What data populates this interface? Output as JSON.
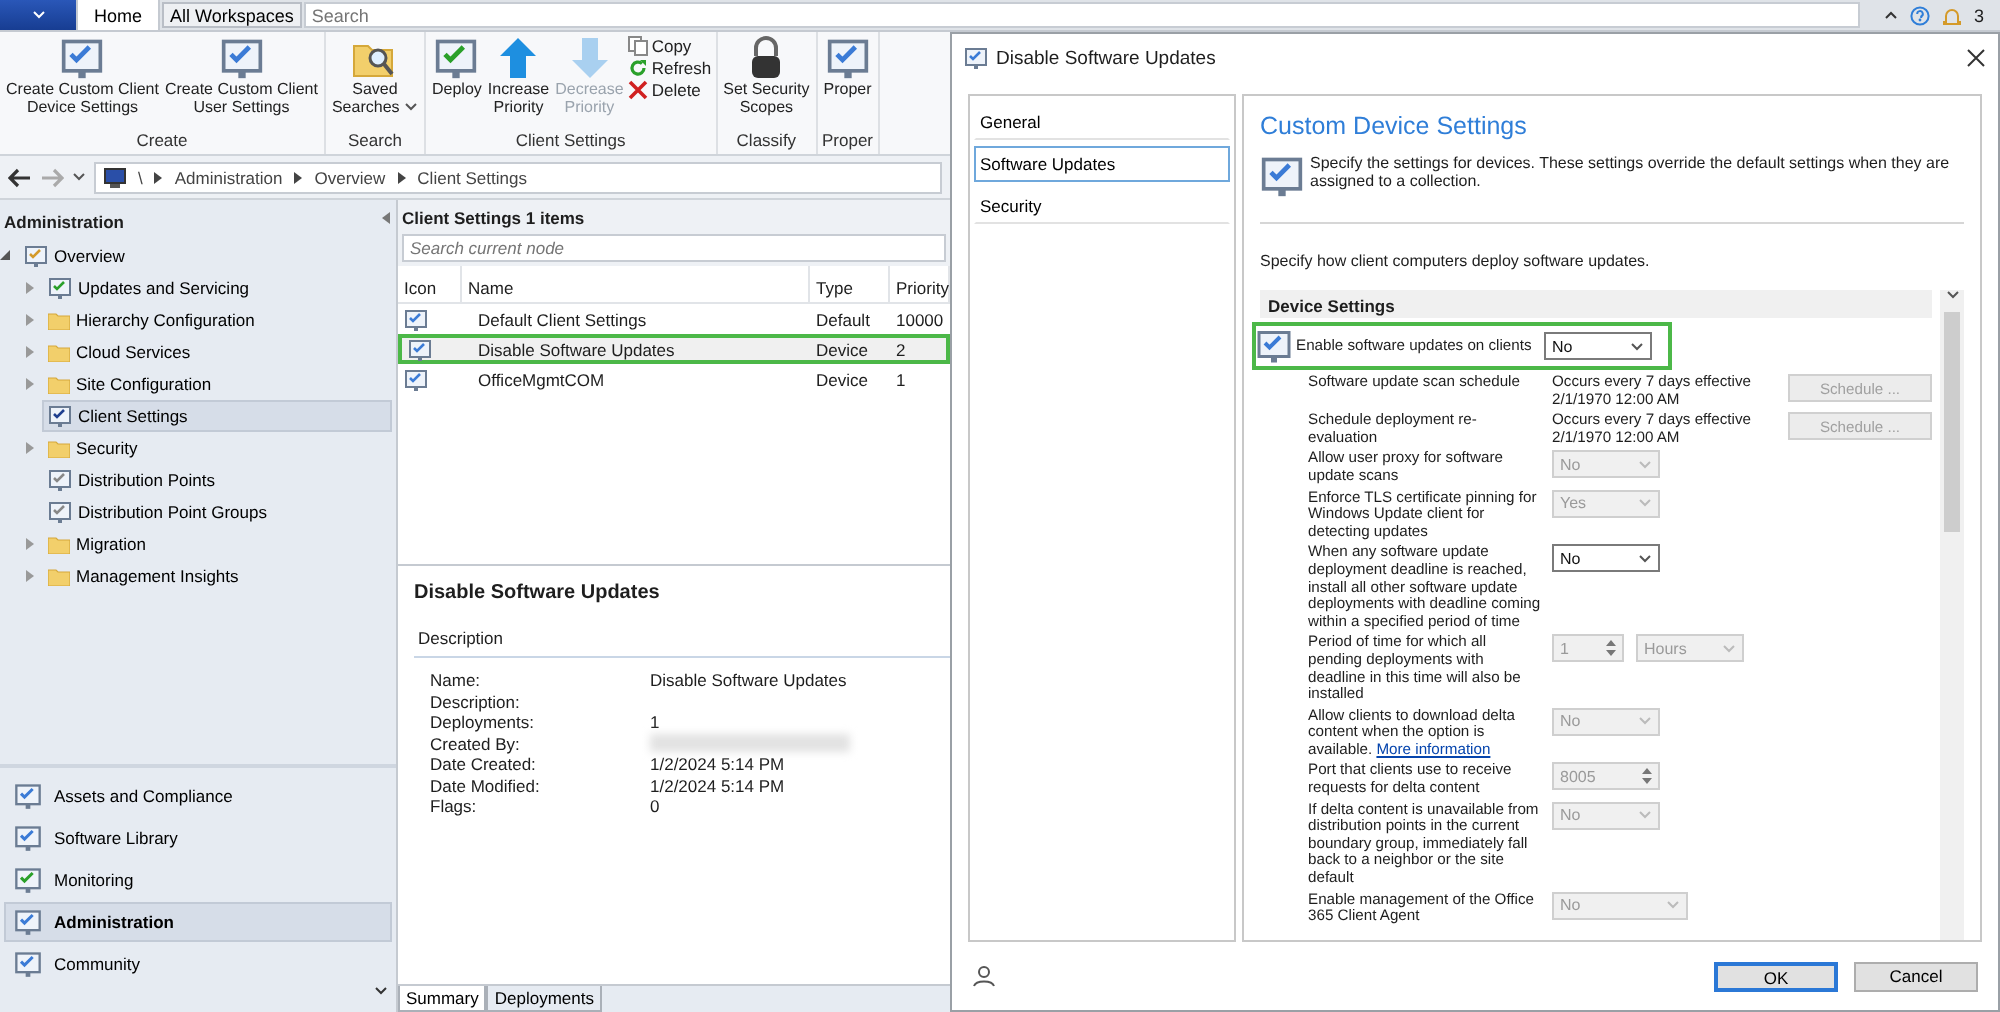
{
  "topbar": {
    "tabs": [
      {
        "label": "Home",
        "selected": true
      }
    ],
    "workspaces_button": "All Workspaces",
    "search": {
      "placeholder": "Search"
    },
    "notifications": "3"
  },
  "ribbon": {
    "groups": [
      {
        "label": "Create",
        "buttons": [
          {
            "kind": "large",
            "label": "Create Custom Client\nDevice Settings",
            "disabled": false
          },
          {
            "kind": "large",
            "label": "Create Custom Client\nUser Settings",
            "disabled": false
          }
        ]
      },
      {
        "label": "Search",
        "buttons": [
          {
            "kind": "menu",
            "label": "Saved\nSearches",
            "disabled": false
          }
        ]
      },
      {
        "label": "Client Settings",
        "buttons": [
          {
            "kind": "large",
            "label": "Deploy",
            "disabled": false
          },
          {
            "kind": "large",
            "label": "Increase\nPriority",
            "disabled": false
          },
          {
            "kind": "large",
            "label": "Decrease\nPriority",
            "disabled": true
          },
          {
            "kind": "small",
            "label": "Copy",
            "disabled": false
          },
          {
            "kind": "small",
            "label": "Refresh",
            "disabled": false
          },
          {
            "kind": "small",
            "label": "Delete",
            "disabled": false
          }
        ]
      },
      {
        "label": "Classify",
        "buttons": [
          {
            "kind": "large",
            "label": "Set Security\nScopes",
            "disabled": false
          }
        ]
      },
      {
        "label": "Proper",
        "buttons": [
          {
            "kind": "large",
            "label": "Proper",
            "disabled": false
          }
        ]
      }
    ]
  },
  "breadcrumb": [
    "\\",
    "Administration",
    "Overview",
    "Client Settings"
  ],
  "navigation": {
    "title": "Administration",
    "tree": [
      {
        "label": "Overview",
        "expanded": true,
        "children": [
          {
            "label": "Updates and Servicing",
            "expandable": true,
            "selected": false
          },
          {
            "label": "Hierarchy Configuration",
            "expandable": true,
            "selected": false
          },
          {
            "label": "Cloud Services",
            "expandable": true,
            "selected": false
          },
          {
            "label": "Site Configuration",
            "expandable": true,
            "selected": false
          },
          {
            "label": "Client Settings",
            "expandable": false,
            "selected": true
          },
          {
            "label": "Security",
            "expandable": true,
            "selected": false
          },
          {
            "label": "Distribution Points",
            "expandable": false,
            "selected": false
          },
          {
            "label": "Distribution Point Groups",
            "expandable": false,
            "selected": false
          },
          {
            "label": "Migration",
            "expandable": true,
            "selected": false
          },
          {
            "label": "Management Insights",
            "expandable": true,
            "selected": false
          }
        ]
      }
    ],
    "workspaces": [
      {
        "label": "Assets and Compliance",
        "selected": false
      },
      {
        "label": "Software Library",
        "selected": false
      },
      {
        "label": "Monitoring",
        "selected": false
      },
      {
        "label": "Administration",
        "selected": true
      },
      {
        "label": "Community",
        "selected": false
      }
    ]
  },
  "list": {
    "title": "Client Settings 1 items",
    "search": {
      "placeholder": "Search current node"
    },
    "columns": [
      "Icon",
      "Name",
      "Type",
      "Priority"
    ],
    "rows": [
      {
        "name": "Default Client Settings",
        "type": "Default",
        "priority": "10000",
        "highlighted": false
      },
      {
        "name": "Disable Software Updates",
        "type": "Device",
        "priority": "2",
        "highlighted": true
      },
      {
        "name": "OfficeMgmtCOM",
        "type": "Device",
        "priority": "1",
        "highlighted": false
      }
    ]
  },
  "details": {
    "title": "Disable Software Updates",
    "section": "Description",
    "properties": [
      {
        "label": "Name:",
        "value": "Disable Software Updates",
        "redacted": false
      },
      {
        "label": "Description:",
        "redacted": false
      },
      {
        "label": "Deployments:",
        "value": "1",
        "redacted": false
      },
      {
        "label": "Created By:",
        "redacted": true
      },
      {
        "label": "Date Created:",
        "value": "1/2/2024 5:14 PM",
        "redacted": false
      },
      {
        "label": "Date Modified:",
        "value": "1/2/2024 5:14 PM",
        "redacted": false
      },
      {
        "label": "Flags:",
        "value": "0",
        "redacted": false
      }
    ],
    "tabs": [
      {
        "label": "Summary",
        "selected": true
      },
      {
        "label": "Deployments",
        "selected": false
      }
    ]
  },
  "dialog": {
    "title": "Disable Software Updates",
    "pages": [
      {
        "label": "General",
        "selected": false
      },
      {
        "label": "Software Updates",
        "selected": true
      },
      {
        "label": "Security",
        "selected": false
      }
    ],
    "heading": "Custom Device Settings",
    "description": "Specify the settings for devices. These settings override the default settings when they are assigned to a collection.",
    "intro": "Specify how client computers deploy software updates.",
    "group": "Device Settings",
    "settings": [
      {
        "kind": "select",
        "label": "Enable software updates on clients",
        "value": "No",
        "disabled": false,
        "highlighted": true
      },
      {
        "kind": "schedule",
        "label": "Software update scan schedule",
        "schedule": "Occurs every 7 days effective 2/1/1970 12:00 AM",
        "button": "Schedule ...",
        "disabled": true,
        "highlighted": false
      },
      {
        "kind": "schedule",
        "label": "Schedule deployment re-evaluation",
        "schedule": "Occurs every 7 days effective 2/1/1970 12:00 AM",
        "button": "Schedule ...",
        "disabled": true,
        "highlighted": false
      },
      {
        "kind": "select",
        "label": "Allow user proxy for software update scans",
        "value": "No",
        "disabled": true,
        "highlighted": false
      },
      {
        "kind": "select",
        "label": "Enforce TLS certificate pinning for Windows Update client for detecting updates",
        "value": "Yes",
        "disabled": true,
        "highlighted": false
      },
      {
        "kind": "select",
        "label": "When any software update deployment deadline is reached, install all other software update deployments with deadline coming within a specified period of time",
        "value": "No",
        "disabled": false,
        "highlighted": false
      },
      {
        "kind": "period",
        "label": "Period of time for which all pending deployments with deadline in this time will also be installed",
        "value": "1",
        "unit": "Hours",
        "disabled": true,
        "highlighted": false
      },
      {
        "kind": "select",
        "label": "Allow clients to download delta content when the option is available.",
        "link": "More information",
        "value": "No",
        "disabled": true,
        "highlighted": false
      },
      {
        "kind": "spin",
        "label": "Port that clients use to receive requests for delta content",
        "value": "8005",
        "disabled": true,
        "highlighted": false
      },
      {
        "kind": "select",
        "label": "If delta content is unavailable from distribution points in the current boundary group, immediately fall back to a neighbor or the site default",
        "value": "No",
        "disabled": true,
        "highlighted": false
      },
      {
        "kind": "select",
        "label": "Enable management of the Office 365 Client Agent",
        "value": "No",
        "disabled": true,
        "highlighted": false
      }
    ],
    "buttons": [
      {
        "label": "OK",
        "default": true
      },
      {
        "label": "Cancel",
        "default": false
      }
    ]
  }
}
